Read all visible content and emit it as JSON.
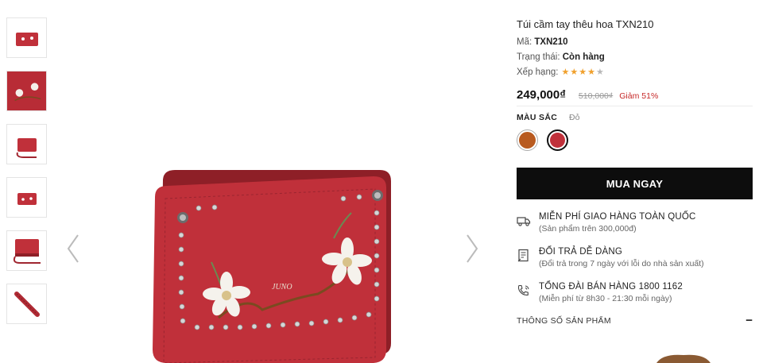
{
  "product": {
    "title": "Túi cầm tay thêu hoa TXN210",
    "code_label": "Mã:",
    "code_value": "TXN210",
    "status_label": "Trạng thái:",
    "status_value": "Còn hàng",
    "rating_label": "Xếp hạng:",
    "rating": 4,
    "rating_max": 5,
    "price": "249,000₫",
    "old_price": "510,000₫",
    "discount": "Giảm 51%",
    "color_label": "MÀU SẮC",
    "color_value": "Đỏ",
    "colors": [
      "#b85a1f",
      "#c0303a"
    ],
    "selected_color": 1,
    "brand_mark": "JUNO"
  },
  "thumbnails": [
    {
      "name": "thumb-front-view"
    },
    {
      "name": "thumb-detail-view"
    },
    {
      "name": "thumb-side-strap-view"
    },
    {
      "name": "thumb-small-front-view"
    },
    {
      "name": "thumb-open-view"
    },
    {
      "name": "thumb-edge-view"
    }
  ],
  "buy_button": "MUA NGAY",
  "perks": [
    {
      "title": "MIỄN PHÍ GIAO HÀNG TOÀN QUỐC",
      "subtitle": "(Sản phẩm trên 300,000đ)",
      "icon": "truck-icon"
    },
    {
      "title": "ĐỔI TRẢ DỄ DÀNG",
      "subtitle": "(Đổi trả trong 7 ngày với lỗi do nhà sản xuất)",
      "icon": "return-doc-icon"
    },
    {
      "title": "TỔNG ĐÀI BÁN HÀNG 1800 1162",
      "subtitle": "(Miễn phí từ 8h30 - 21:30 mỗi ngày)",
      "icon": "phone-support-icon"
    }
  ],
  "specs": {
    "label": "THÔNG SỐ SẢN PHẨM",
    "toggle": "−"
  },
  "colors": {
    "bag_red": "#c0303a",
    "bag_dark": "#8e1f27",
    "buy_bg": "#0d0d0d",
    "price_accent": "#c62828",
    "star": "#f0a02c"
  }
}
